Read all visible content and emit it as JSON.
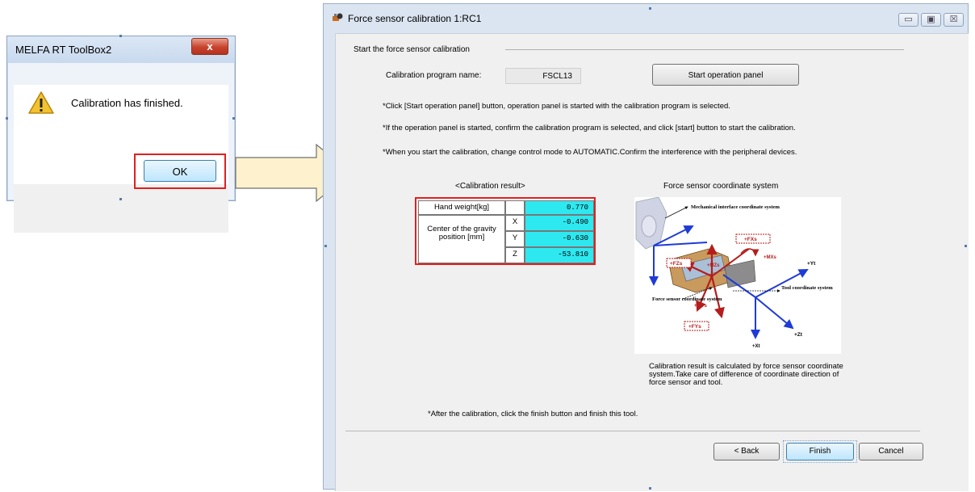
{
  "message_box": {
    "title": "MELFA RT ToolBox2",
    "close_label": "x",
    "message": "Calibration has finished.",
    "ok_label": "OK",
    "icon": "warning-icon"
  },
  "arrow": {
    "icon": "right-arrow-icon"
  },
  "window": {
    "title": "Force sensor calibration 1:RC1",
    "minimize_label": "▭",
    "maximize_label": "▣",
    "close_label": "☒",
    "section_title": "Start the force sensor calibration",
    "program_label": "Calibration program name:",
    "program_value": "FSCL13",
    "start_button": "Start operation panel",
    "notes": [
      "*Click [Start operation panel] button, operation panel is started with the calibration program is selected.",
      "*If the operation panel is started, confirm the calibration program is selected, and click [start] button to start the calibration.",
      "*When you start the calibration, change control mode to AUTOMATIC.Confirm the interference with the peripheral devices."
    ],
    "result_title": "<Calibration result>",
    "result": {
      "hand_weight_label": "Hand weight[kg]",
      "hand_weight": "0.770",
      "cog_label": "Center of the gravity position [mm]",
      "x_label": "X",
      "x": "-0.490",
      "y_label": "Y",
      "y": "-0.630",
      "z_label": "Z",
      "z": "-53.810"
    },
    "coord_title": "Force sensor coordinate system",
    "diagram_labels": {
      "mech": "Mechanical interface coordinate system",
      "fxs": "+FXs",
      "fzs": "+FZs",
      "mzs": "+MZs",
      "mxs": "+MXs",
      "yt": "+Yt",
      "tool": "Tool coordinate system",
      "sensor": "Force sensor coordinate system",
      "mys": "+MYs",
      "fys": "+FYs",
      "zt": "+Zt",
      "xt": "+Xt"
    },
    "calib_note": "Calibration result is calculated by force sensor coordinate system.Take care of difference of coordinate direction of force sensor and tool.",
    "after_note": "*After the calibration, click the finish button and finish this tool.",
    "back_button": "< Back",
    "finish_button": "Finish",
    "cancel_button": "Cancel"
  }
}
